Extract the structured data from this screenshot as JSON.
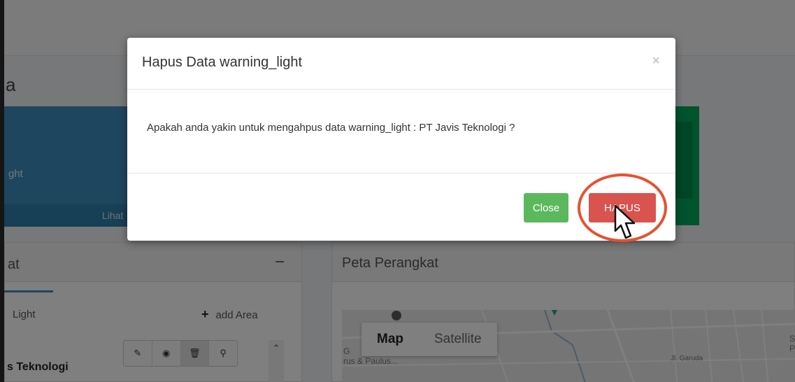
{
  "background": {
    "page_title_fragment": "a",
    "blue_box": {
      "label_fragment": "ght",
      "footer_fragment": "Lihat"
    },
    "left_panel": {
      "title_fragment": "at",
      "minus_symbol": "−",
      "tab_label": "Light",
      "add_area_label": "add Area",
      "company_name_fragment": "s Teknologi",
      "row_actions": [
        "edit-icon",
        "view-icon",
        "delete-icon",
        "location-icon"
      ]
    },
    "right_panel": {
      "title": "Peta Perangkat",
      "map_button": "Map",
      "satellite_button": "Satellite",
      "map_labels": [
        "G",
        "rus & Paulus...",
        "Jl. Garuda",
        "S",
        "P"
      ]
    }
  },
  "modal": {
    "title": "Hapus Data warning_light",
    "close_symbol": "×",
    "message": "Apakah anda yakin untuk mengahpus data warning_light : PT Javis Teknologi ?",
    "close_button": "Close",
    "delete_button": "HAPUS"
  },
  "colors": {
    "close_button": "#5cb85c",
    "delete_button": "#d9534f",
    "highlight_ring": "#e8512e",
    "blue_box": "#3c8dbc",
    "green_box": "#00a65a"
  }
}
